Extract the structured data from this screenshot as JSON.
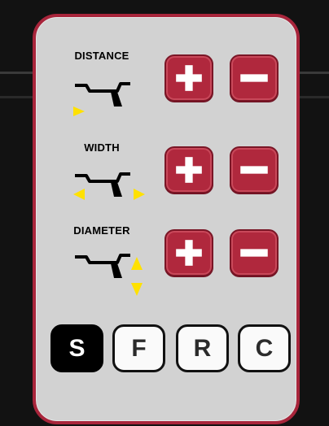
{
  "rows": [
    {
      "label": "DISTANCE",
      "plus_icon": "plus-icon",
      "minus_icon": "minus-icon"
    },
    {
      "label": "WIDTH",
      "plus_icon": "plus-icon",
      "minus_icon": "minus-icon"
    },
    {
      "label": "DIAMETER",
      "plus_icon": "plus-icon",
      "minus_icon": "minus-icon"
    }
  ],
  "selectors": [
    {
      "label": "S",
      "active": true
    },
    {
      "label": "F",
      "active": false
    },
    {
      "label": "R",
      "active": false
    },
    {
      "label": "C",
      "active": false
    }
  ],
  "colors": {
    "panel": "#d2d2d2",
    "border": "#a8253b",
    "button": "#b0283d",
    "arrow": "#ffe100",
    "background": "#121212"
  }
}
